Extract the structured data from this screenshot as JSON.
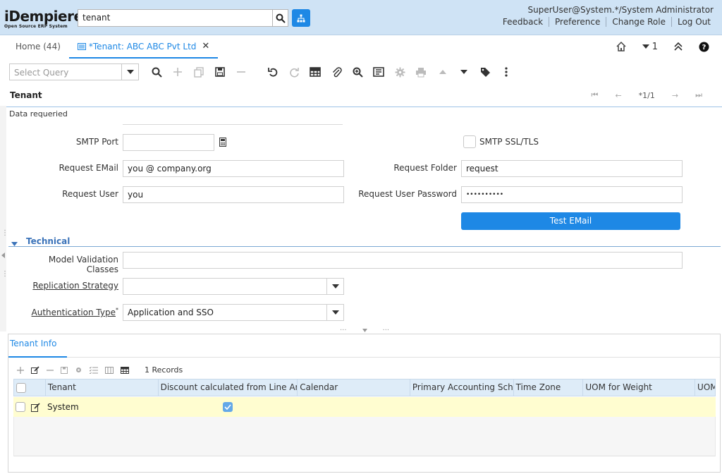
{
  "header": {
    "logo_main": "iDempiere",
    "logo_sub": "Open Source ERP System",
    "search_value": "tenant",
    "user": "SuperUser@System.*/System Administrator",
    "links": [
      "Feedback",
      "Preference",
      "Change Role",
      "Log Out"
    ]
  },
  "tabs": {
    "home": "Home (44)",
    "active": "*Tenant: ABC ABC Pvt Ltd",
    "count": "1"
  },
  "toolbar": {
    "query_placeholder": "Select Query"
  },
  "record": {
    "title": "Tenant",
    "position": "*1/1",
    "status": "Data requeried"
  },
  "form": {
    "smtp_port_label": "SMTP Port",
    "smtp_port_value": "",
    "smtp_ssl_label": "SMTP SSL/TLS",
    "request_email_label": "Request EMail",
    "request_email_value": "you @ company.org",
    "request_folder_label": "Request Folder",
    "request_folder_value": "request",
    "request_user_label": "Request User",
    "request_user_value": "you",
    "request_user_password_label": "Request User Password",
    "request_user_password_value": "••••••••••",
    "test_email_button": "Test EMail",
    "section_technical": "Technical",
    "model_validation_label": "Model Validation Classes",
    "model_validation_value": "",
    "replication_strategy_label": "Replication Strategy",
    "replication_strategy_value": "",
    "authentication_type_label": "Authentication Type",
    "authentication_type_required": "*",
    "authentication_type_value": "Application and SSO"
  },
  "detail": {
    "tab": "Tenant Info",
    "records": "1 Records",
    "columns": [
      "Tenant",
      "Discount calculated from Line Amounts",
      "Calendar",
      "Primary Accounting Schema",
      "Time Zone",
      "UOM for Weight",
      "UOM"
    ],
    "row": {
      "tenant": "System",
      "discount_checked": true
    }
  },
  "colors": {
    "accent": "#1e88e5",
    "header_bg": "#cfe3f5",
    "row_highlight": "#fffdd0"
  }
}
